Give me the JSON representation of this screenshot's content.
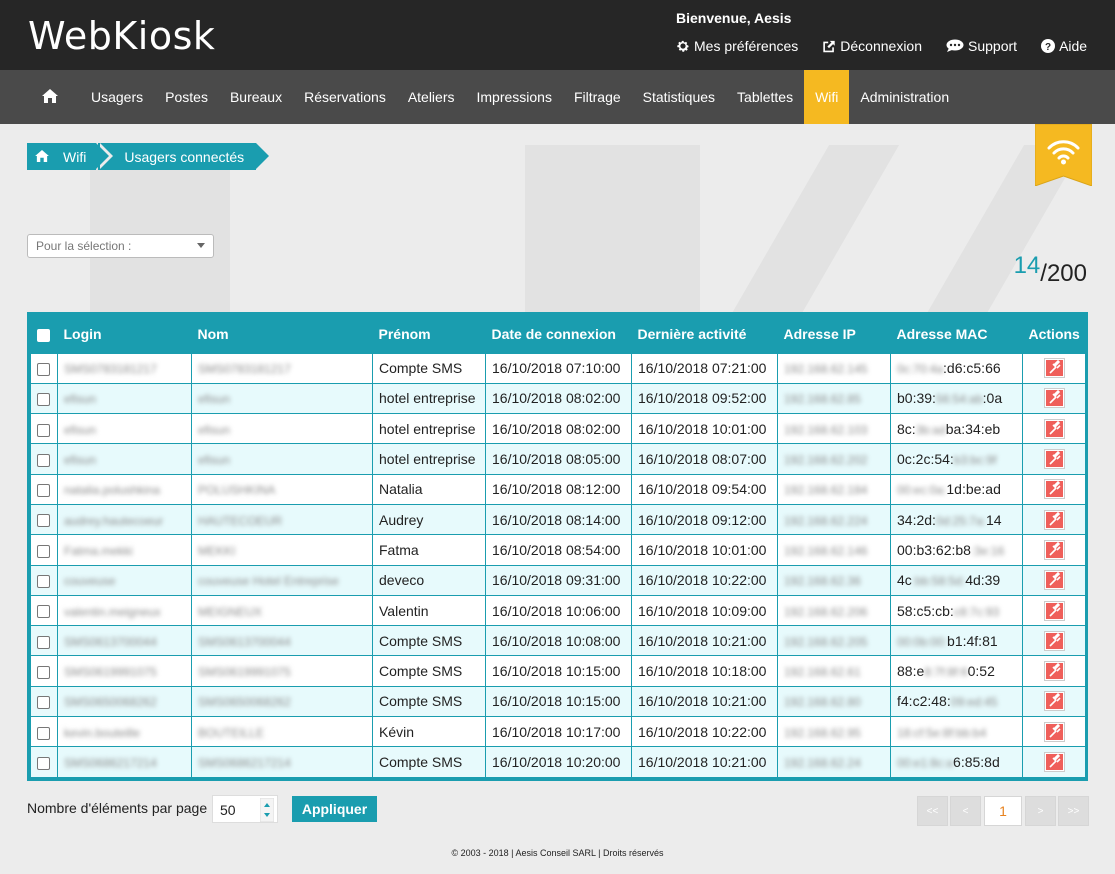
{
  "header": {
    "logo": "WebKiosk",
    "welcome": "Bienvenue, Aesis",
    "links": [
      {
        "label": "Mes préférences",
        "icon": "gear-icon"
      },
      {
        "label": "Déconnexion",
        "icon": "external-link-icon"
      },
      {
        "label": "Support",
        "icon": "chat-icon"
      },
      {
        "label": "Aide",
        "icon": "help-icon"
      }
    ]
  },
  "nav": {
    "items": [
      "Usagers",
      "Postes",
      "Bureaux",
      "Réservations",
      "Ateliers",
      "Impressions",
      "Filtrage",
      "Statistiques",
      "Tablettes",
      "Wifi",
      "Administration"
    ],
    "active": "Wifi",
    "active_color": "#f5b921"
  },
  "breadcrumb": {
    "root": "Wifi",
    "current": "Usagers connectés"
  },
  "select": {
    "placeholder": "Pour la sélection :"
  },
  "counter": {
    "current": "14",
    "separator": "/",
    "total": "200"
  },
  "table": {
    "headers": [
      "Login",
      "Nom",
      "Prénom",
      "Date de connexion",
      "Dernière activité",
      "Adresse IP",
      "Adresse MAC",
      "Actions"
    ],
    "rows": [
      {
        "login": "SMS0783181217",
        "nom": "SMS0783181217",
        "prenom": "Compte SMS",
        "connexion": "16/10/2018 07:10:00",
        "activite": "16/10/2018 07:21:00",
        "ip": "192.168.62.145",
        "mac_hidden": "0c:70:4a",
        "mac_visible": ":d6:c5:66"
      },
      {
        "login": "efisun",
        "nom": "efisun",
        "prenom": "hotel entreprise",
        "connexion": "16/10/2018 08:02:00",
        "activite": "16/10/2018 09:52:00",
        "ip": "192.168.62.85",
        "mac_visible": "b0:39:",
        "mac_hidden": "56:54:ab",
        "mac_tail": ":0a"
      },
      {
        "login": "efisun",
        "nom": "efisun",
        "prenom": "hotel entreprise",
        "connexion": "16/10/2018 08:02:00",
        "activite": "16/10/2018 10:01:00",
        "ip": "192.168.62.103",
        "mac_visible": "8c:",
        "mac_hidden": "3b:ad",
        "mac_tail": "ba:34:eb"
      },
      {
        "login": "efisun",
        "nom": "efisun",
        "prenom": "hotel entreprise",
        "connexion": "16/10/2018 08:05:00",
        "activite": "16/10/2018 08:07:00",
        "ip": "192.168.62.202",
        "mac_visible": "0c:2c:54:",
        "mac_hidden": "b3:bc:9f",
        "mac_tail": ""
      },
      {
        "login": "natalia.polushkina",
        "nom": "POLUSHKINA",
        "prenom": "Natalia",
        "connexion": "16/10/2018 08:12:00",
        "activite": "16/10/2018 09:54:00",
        "ip": "192.168.62.184",
        "mac_hidden": "00:ec:0a:",
        "mac_visible": "1d:be:ad"
      },
      {
        "login": "audrey.hautecoeur",
        "nom": "HAUTECOEUR",
        "prenom": "Audrey",
        "connexion": "16/10/2018 08:14:00",
        "activite": "16/10/2018 09:12:00",
        "ip": "192.168.62.224",
        "mac_visible": "34:2d:",
        "mac_hidden": "0d:25:7a:",
        "mac_tail": "14"
      },
      {
        "login": "Fatma.mekki",
        "nom": "MEKKI",
        "prenom": "Fatma",
        "connexion": "16/10/2018 08:54:00",
        "activite": "16/10/2018 10:01:00",
        "ip": "192.168.62.146",
        "mac_visible": "00:b3:62:b8",
        "mac_hidden": ":3e:16",
        "mac_tail": ""
      },
      {
        "login": "couveuse",
        "nom": "couveuse Hotel Entreprise",
        "prenom": "deveco",
        "connexion": "16/10/2018 09:31:00",
        "activite": "16/10/2018 10:22:00",
        "ip": "192.168.62.36",
        "mac_visible": "4c",
        "mac_hidden": ":bb:58:5d:",
        "mac_tail": "4d:39"
      },
      {
        "login": "valentin.meigneux",
        "nom": "MEIGNEUX",
        "prenom": "Valentin",
        "connexion": "16/10/2018 10:06:00",
        "activite": "16/10/2018 10:09:00",
        "ip": "192.168.62.206",
        "mac_visible": "58:c5:cb:",
        "mac_hidden": "c8:7c:93",
        "mac_tail": ""
      },
      {
        "login": "SMS0613700044",
        "nom": "SMS0613700044",
        "prenom": "Compte SMS",
        "connexion": "16/10/2018 10:08:00",
        "activite": "16/10/2018 10:21:00",
        "ip": "192.168.62.205",
        "mac_hidden": "00:0b:00:",
        "mac_visible": "b1:4f:81"
      },
      {
        "login": "SMS0619991075",
        "nom": "SMS0619991075",
        "prenom": "Compte SMS",
        "connexion": "16/10/2018 10:15:00",
        "activite": "16/10/2018 10:18:00",
        "ip": "192.168.62.61",
        "mac_visible": "88:e",
        "mac_hidden": "8:7f:8f:6",
        "mac_tail": "0:52"
      },
      {
        "login": "SMS0650068262",
        "nom": "SMS0650068262",
        "prenom": "Compte SMS",
        "connexion": "16/10/2018 10:15:00",
        "activite": "16/10/2018 10:21:00",
        "ip": "192.168.62.80",
        "mac_visible": "f4:c2:48:",
        "mac_hidden": "09:ed:45",
        "mac_tail": ""
      },
      {
        "login": "kevin.bouteille",
        "nom": "BOUTEILLE",
        "prenom": "Kévin",
        "connexion": "16/10/2018 10:17:00",
        "activite": "16/10/2018 10:22:00",
        "ip": "192.168.62.95",
        "mac_hidden": "18:cf:5e:8f:bb:b4",
        "mac_visible": ""
      },
      {
        "login": "SMS0686217214",
        "nom": "SMS0686217214",
        "prenom": "Compte SMS",
        "connexion": "16/10/2018 10:20:00",
        "activite": "16/10/2018 10:21:00",
        "ip": "192.168.62.24",
        "mac_hidden": "00:e1:8c:a",
        "mac_visible": "6:85:8d"
      }
    ]
  },
  "footer": {
    "per_page_label": "Nombre d'éléments par page",
    "per_page_value": "50",
    "apply": "Appliquer",
    "pager": {
      "first": "<<",
      "prev": "<",
      "page": "1",
      "next": ">",
      "last": ">>"
    },
    "copyright": "© 2003 - 2018 | Aesis Conseil SARL | Droits réservés"
  },
  "colors": {
    "accent": "#1a9daf",
    "active_tab": "#f5b921",
    "header": "#262626",
    "nav": "#4a4a4a"
  }
}
